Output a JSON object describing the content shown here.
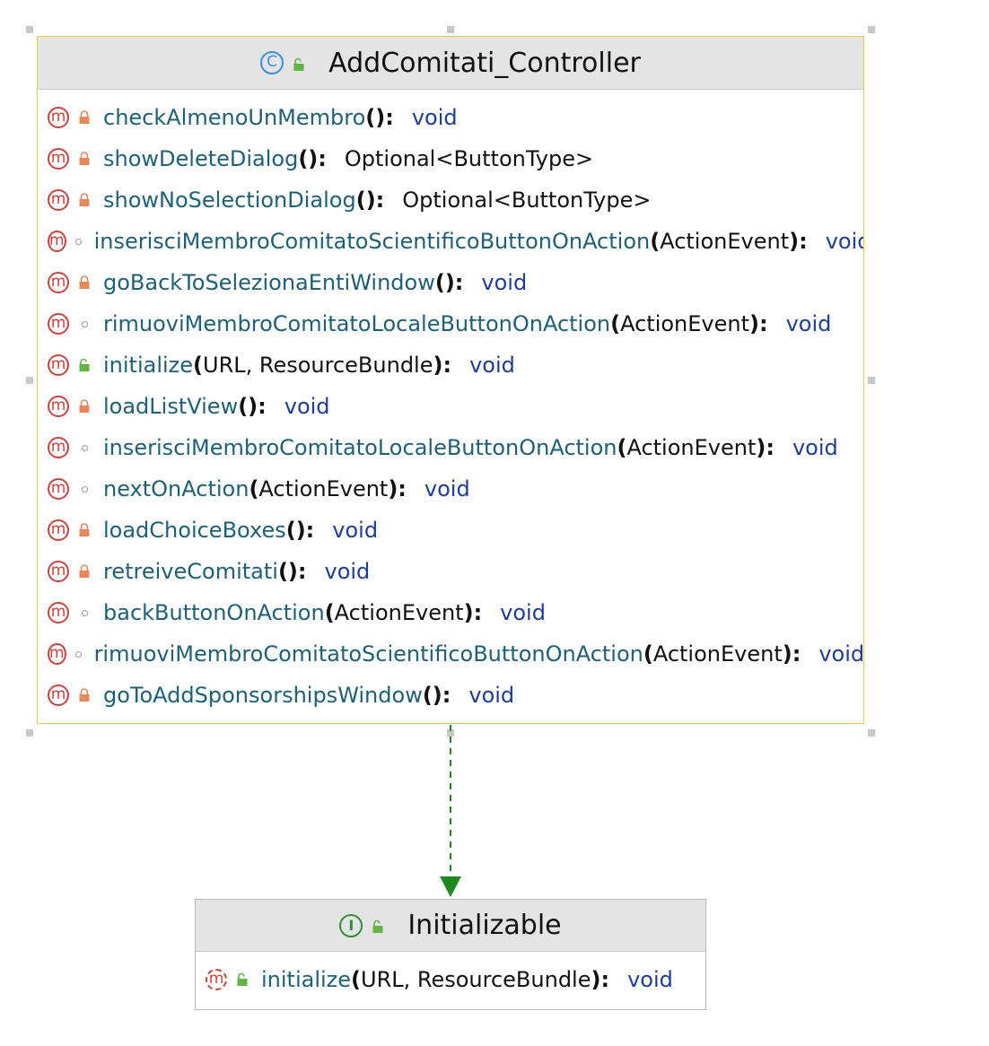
{
  "class_box": {
    "stereotype_icon": "class-icon",
    "visibility_icon": "public-unlock-icon",
    "title": "AddComitati_Controller",
    "methods": [
      {
        "visibility": "private",
        "name": "checkAlmenoUnMembro",
        "open": "(",
        "params": "",
        "close": "):",
        "return": "void",
        "return_kind": "keyword"
      },
      {
        "visibility": "private",
        "name": "showDeleteDialog",
        "open": "(",
        "params": "",
        "close": "):",
        "return": "Optional<ButtonType>",
        "return_kind": "type"
      },
      {
        "visibility": "private",
        "name": "showNoSelectionDialog",
        "open": "(",
        "params": "",
        "close": "):",
        "return": "Optional<ButtonType>",
        "return_kind": "type"
      },
      {
        "visibility": "package",
        "name": "inserisciMembroComitatoScientificoButtonOnAction",
        "open": "(",
        "params": "ActionEvent",
        "close": "):",
        "return": "void",
        "return_kind": "keyword"
      },
      {
        "visibility": "private",
        "name": "goBackToSelezionaEntiWindow",
        "open": "(",
        "params": "",
        "close": "):",
        "return": "void",
        "return_kind": "keyword"
      },
      {
        "visibility": "package",
        "name": "rimuoviMembroComitatoLocaleButtonOnAction",
        "open": "(",
        "params": "ActionEvent",
        "close": "):",
        "return": "void",
        "return_kind": "keyword"
      },
      {
        "visibility": "public",
        "name": "initialize",
        "open": "(",
        "params": "URL, ResourceBundle",
        "close": "):",
        "return": "void",
        "return_kind": "keyword"
      },
      {
        "visibility": "private",
        "name": "loadListView",
        "open": "(",
        "params": "",
        "close": "):",
        "return": "void",
        "return_kind": "keyword"
      },
      {
        "visibility": "package",
        "name": "inserisciMembroComitatoLocaleButtonOnAction",
        "open": "(",
        "params": "ActionEvent",
        "close": "):",
        "return": "void",
        "return_kind": "keyword"
      },
      {
        "visibility": "package",
        "name": "nextOnAction",
        "open": "(",
        "params": "ActionEvent",
        "close": "):",
        "return": "void",
        "return_kind": "keyword"
      },
      {
        "visibility": "private",
        "name": "loadChoiceBoxes",
        "open": "(",
        "params": "",
        "close": "):",
        "return": "void",
        "return_kind": "keyword"
      },
      {
        "visibility": "private",
        "name": "retreiveComitati",
        "open": "(",
        "params": "",
        "close": "):",
        "return": "void",
        "return_kind": "keyword"
      },
      {
        "visibility": "package",
        "name": "backButtonOnAction",
        "open": "(",
        "params": "ActionEvent",
        "close": "):",
        "return": "void",
        "return_kind": "keyword"
      },
      {
        "visibility": "package",
        "name": "rimuoviMembroComitatoScientificoButtonOnAction",
        "open": "(",
        "params": "ActionEvent",
        "close": "):",
        "return": "void",
        "return_kind": "keyword"
      },
      {
        "visibility": "private",
        "name": "goToAddSponsorshipsWindow",
        "open": "(",
        "params": "",
        "close": "):",
        "return": "void",
        "return_kind": "keyword"
      }
    ]
  },
  "interface_box": {
    "stereotype_icon": "interface-icon",
    "visibility_icon": "public-unlock-icon",
    "title": "Initializable",
    "methods": [
      {
        "visibility": "public",
        "abstract": true,
        "name": "initialize",
        "open": "(",
        "params": "URL, ResourceBundle",
        "close": "):",
        "return": "void",
        "return_kind": "keyword"
      }
    ]
  },
  "relation": {
    "type": "implements",
    "style": "dashed",
    "color": "#1e8a1e"
  },
  "colors": {
    "class_border": "#f6c54a",
    "method_name": "#1d6178",
    "keyword": "#1f3c9a",
    "private_lock": "#e8875a",
    "public_unlock": "#62b543"
  }
}
